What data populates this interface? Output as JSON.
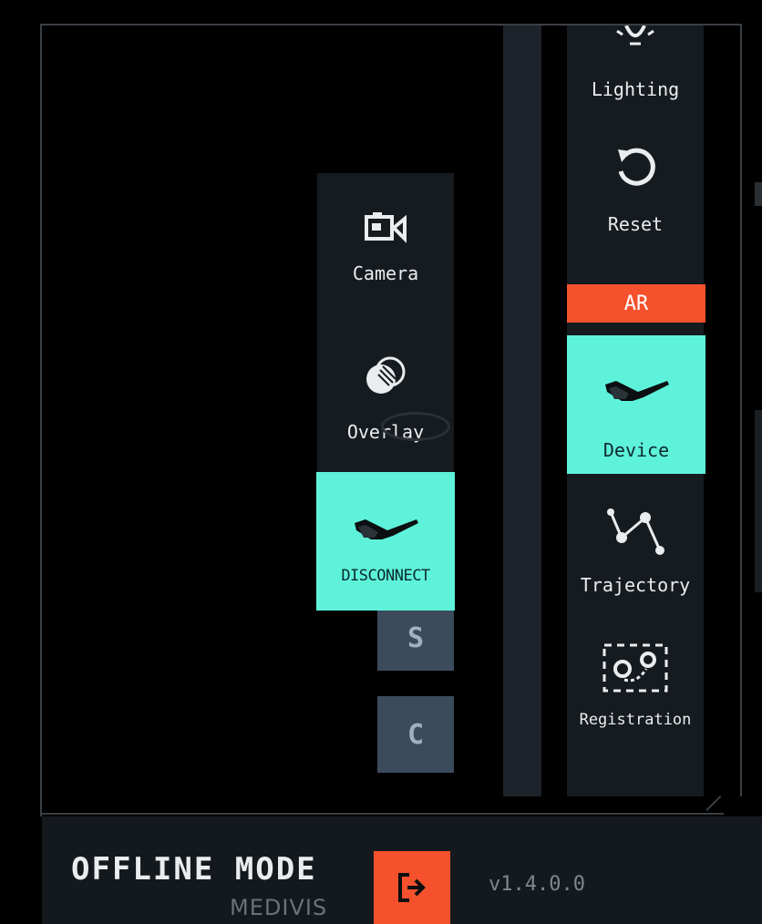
{
  "left_toolbar": {
    "camera": {
      "label": "Camera",
      "icon": "camera-icon"
    },
    "overlay": {
      "label": "Overlay",
      "icon": "overlay-icon"
    },
    "disconnect": {
      "label": "DISCONNECT",
      "icon": "ar-glasses-icon"
    },
    "s_button": "S",
    "c_button": "C"
  },
  "right_toolbar": {
    "lighting": {
      "label": "Lighting",
      "icon": "lightbulb-icon"
    },
    "reset": {
      "label": "Reset",
      "icon": "reset-icon"
    },
    "ar_badge": "AR",
    "device": {
      "label": "Device",
      "icon": "ar-glasses-icon"
    },
    "trajectory": {
      "label": "Trajectory",
      "icon": "trajectory-icon"
    },
    "registration": {
      "label": "Registration",
      "icon": "registration-icon"
    }
  },
  "footer": {
    "mode": "OFFLINE MODE",
    "brand": "MEDIVIS",
    "exit_icon": "exit-icon",
    "version": "v1.4.0.0"
  },
  "colors": {
    "accent_teal": "#5ef2db",
    "accent_orange": "#f4512c",
    "panel": "#161b20",
    "slate": "#3b4b5c"
  }
}
